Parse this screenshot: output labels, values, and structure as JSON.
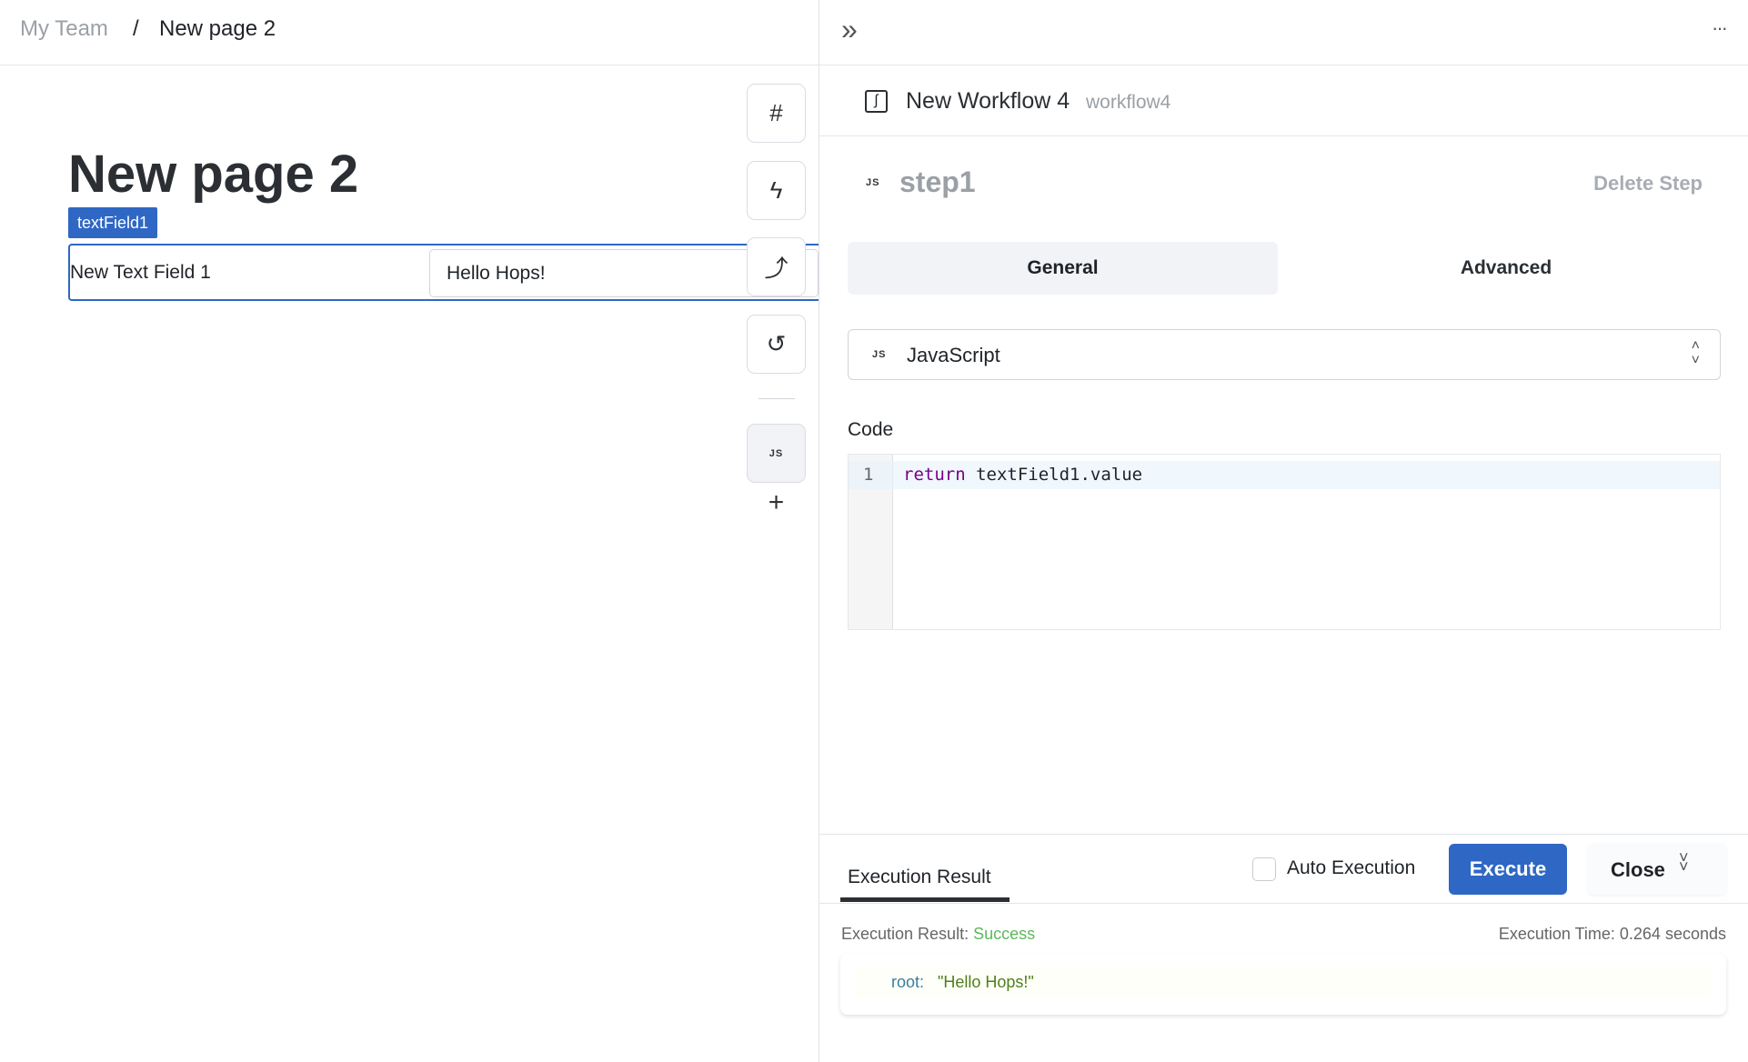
{
  "breadcrumb": {
    "team": "My Team",
    "separator": "/",
    "page": "New page 2"
  },
  "canvas": {
    "title": "New page 2",
    "component_badge": "textField1",
    "text_field": {
      "label": "New Text Field 1",
      "value": "Hello Hops!"
    }
  },
  "toolbar": {
    "items": [
      {
        "icon": "hash-icon",
        "glyph": "#"
      },
      {
        "icon": "lightning-icon",
        "glyph": "ϟ"
      },
      {
        "icon": "route-icon",
        "glyph": "⤴"
      },
      {
        "icon": "history-icon",
        "glyph": "↺"
      }
    ],
    "js_label": "JS",
    "add_glyph": "+"
  },
  "panel": {
    "collapse_glyph": "»",
    "more_glyph": "···",
    "workflow_name": "New Workflow 4",
    "workflow_id": "workflow4",
    "step": {
      "type_badge": "JS",
      "name": "step1",
      "delete_label": "Delete Step"
    },
    "tabs": [
      {
        "label": "General",
        "active": true
      },
      {
        "label": "Advanced",
        "active": false
      }
    ],
    "language": {
      "badge": "JS",
      "value": "JavaScript"
    },
    "code_label": "Code",
    "code": {
      "line_number": "1",
      "keyword": "return",
      "rest": " textField1.value"
    },
    "result": {
      "tab": "Execution Result",
      "auto_execution_label": "Auto Execution",
      "auto_execution_checked": false,
      "execute_label": "Execute",
      "close_label": "Close",
      "status_prefix": "Execution Result: ",
      "status": "Success",
      "time": "Execution Time: 0.264 seconds",
      "root_key": "root:",
      "root_value": "\"Hello Hops!\""
    },
    "colors": {
      "accent": "#2f67c4",
      "success": "#5cb85c"
    }
  }
}
